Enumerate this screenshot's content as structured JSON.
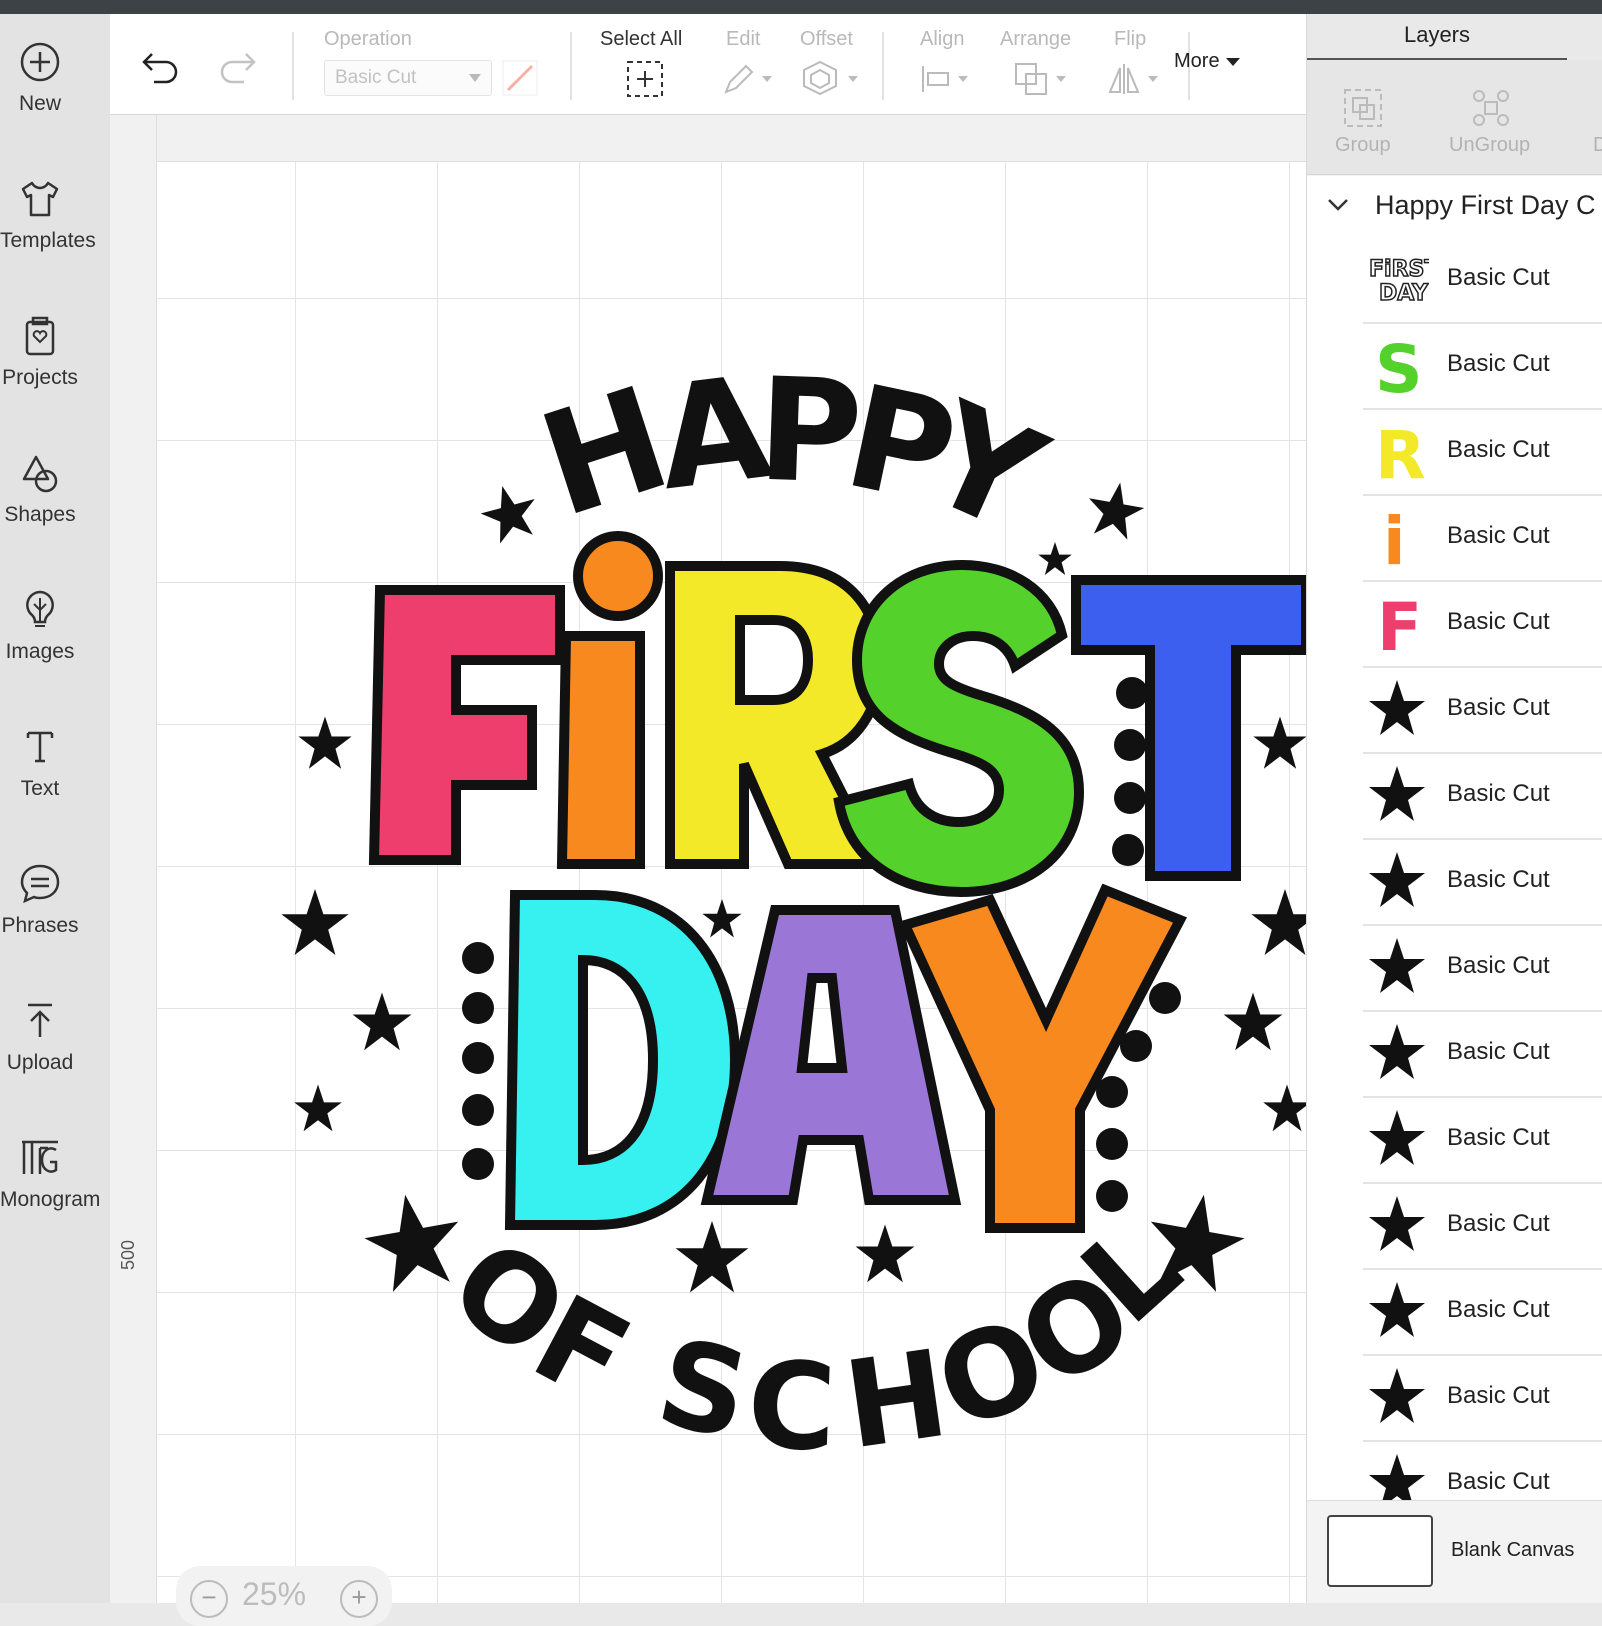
{
  "sidebar": {
    "items": [
      {
        "label": "New",
        "icon": "plus-circle-icon"
      },
      {
        "label": "Templates",
        "icon": "tshirt-icon"
      },
      {
        "label": "Projects",
        "icon": "projects-icon"
      },
      {
        "label": "Shapes",
        "icon": "shapes-icon"
      },
      {
        "label": "Images",
        "icon": "lightbulb-icon"
      },
      {
        "label": "Text",
        "icon": "text-icon"
      },
      {
        "label": "Phrases",
        "icon": "speech-bubble-icon"
      },
      {
        "label": "Upload",
        "icon": "upload-icon"
      },
      {
        "label": "Monogram",
        "icon": "monogram-icon"
      }
    ]
  },
  "toolbar": {
    "operation_label": "Operation",
    "operation_value": "Basic Cut",
    "select_all_label": "Select All",
    "edit_label": "Edit",
    "offset_label": "Offset",
    "align_label": "Align",
    "arrange_label": "Arrange",
    "flip_label": "Flip",
    "more_label": "More"
  },
  "canvas": {
    "ruler_mark": "500",
    "zoom_value": "25%",
    "artwork": {
      "line1": "HAPPY",
      "letters_first": [
        {
          "char": "F",
          "color": "#ee3e6e"
        },
        {
          "char": "i",
          "color": "#f7891f"
        },
        {
          "char": "R",
          "color": "#f3e928"
        },
        {
          "char": "S",
          "color": "#55d12c"
        },
        {
          "char": "T",
          "color": "#3c5ff0"
        }
      ],
      "letters_day": [
        {
          "char": "D",
          "color": "#37f0f0"
        },
        {
          "char": "A",
          "color": "#9a77d6"
        },
        {
          "char": "Y",
          "color": "#f7891f"
        }
      ],
      "line4": "OF SCHOOL"
    }
  },
  "layers": {
    "tab_label": "Layers",
    "group_label": "Group",
    "ungroup_label": "UnGroup",
    "group_name": "Happy First Day C",
    "rows": [
      {
        "name": "Basic Cut",
        "thumb": "first-day"
      },
      {
        "name": "Basic Cut",
        "thumb": "S",
        "color": "#55d12c"
      },
      {
        "name": "Basic Cut",
        "thumb": "R",
        "color": "#f3e928"
      },
      {
        "name": "Basic Cut",
        "thumb": "i",
        "color": "#f7891f"
      },
      {
        "name": "Basic Cut",
        "thumb": "F",
        "color": "#ee3e6e"
      },
      {
        "name": "Basic Cut",
        "thumb": "star"
      },
      {
        "name": "Basic Cut",
        "thumb": "star"
      },
      {
        "name": "Basic Cut",
        "thumb": "star"
      },
      {
        "name": "Basic Cut",
        "thumb": "star"
      },
      {
        "name": "Basic Cut",
        "thumb": "star"
      },
      {
        "name": "Basic Cut",
        "thumb": "star"
      },
      {
        "name": "Basic Cut",
        "thumb": "star"
      },
      {
        "name": "Basic Cut",
        "thumb": "star"
      },
      {
        "name": "Basic Cut",
        "thumb": "star"
      },
      {
        "name": "Basic Cut",
        "thumb": "star"
      }
    ],
    "blank_canvas_label": "Blank Canvas"
  }
}
